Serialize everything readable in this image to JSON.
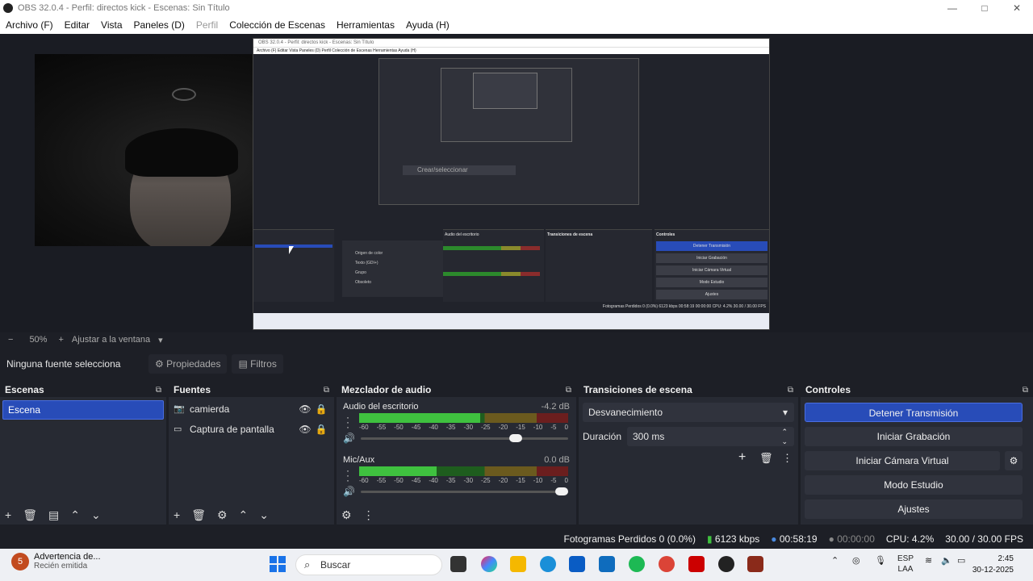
{
  "window": {
    "title": "OBS 32.0.4 - Perfil: directos kick - Escenas: Sin Título",
    "controls": {
      "minimize": "—",
      "maximize": "□",
      "close": "✕"
    }
  },
  "menu": {
    "items": [
      "Archivo (F)",
      "Editar",
      "Vista",
      "Paneles (D)",
      "Perfil",
      "Colección de Escenas",
      "Herramientas",
      "Ayuda (H)"
    ]
  },
  "zoom": {
    "minus": "−",
    "percent": "50%",
    "plus": "+",
    "fit": "Ajustar a la ventana",
    "arrow": "▾"
  },
  "context": {
    "no_source": "Ninguna fuente selecciona",
    "properties": "Propiedades",
    "filters": "Filtros"
  },
  "scenes": {
    "title": "Escenas",
    "items": [
      "Escena"
    ]
  },
  "sources": {
    "title": "Fuentes",
    "items": [
      {
        "name": "camierda",
        "icon": "camera-icon"
      },
      {
        "name": "Captura de pantalla",
        "icon": "monitor-icon"
      }
    ]
  },
  "mixer": {
    "title": "Mezclador de audio",
    "ticks": [
      "-60",
      "-55",
      "-50",
      "-45",
      "-40",
      "-35",
      "-30",
      "-25",
      "-20",
      "-15",
      "-10",
      "-5",
      "0"
    ],
    "channels": [
      {
        "name": "Audio del escritorio",
        "db": "-4.2 dB",
        "level": 0.58,
        "volume": 0.78
      },
      {
        "name": "Mic/Aux",
        "db": "0.0 dB",
        "level": 0.37,
        "volume": 1.0
      }
    ]
  },
  "transitions": {
    "title": "Transiciones de escena",
    "selected": "Desvanecimiento",
    "duration_label": "Duración",
    "duration_value": "300 ms"
  },
  "controls": {
    "title": "Controles",
    "stop_stream": "Detener Transmisión",
    "start_recording": "Iniciar Grabación",
    "virtual_camera": "Iniciar Cámara Virtual",
    "studio_mode": "Modo Estudio",
    "settings": "Ajustes"
  },
  "status": {
    "dropped": "Fotogramas Perdidos 0 (0.0%)",
    "bitrate": "6123 kbps",
    "stream_time": "00:58:19",
    "rec_time": "00:00:00",
    "cpu": "CPU: 4.2%",
    "fps": "30.00 / 30.00 FPS"
  },
  "nested_preview": {
    "title": "OBS 32.0.4 - Perfil: directos kick - Escenas: Sin Título",
    "menu": "Archivo (F)   Editar   Vista   Paneles (D)   Perfil   Colección de Escenas   Herramientas   Ayuda (H)",
    "tooltip": "Crear/seleccionar",
    "context_items": [
      "Origen de color",
      "Texto (GDI+)",
      "Grupo",
      "Obsoleto"
    ],
    "audio_label": "Audio del escritorio",
    "transitions": "Transiciones de escena",
    "controls": "Controles",
    "buttons": [
      "Detener Transmisión",
      "Iniciar Grabación",
      "Iniciar Cámara Virtual",
      "Modo Estudio",
      "Ajustes"
    ],
    "status": "Fotogramas Perdidos 0 (0.0%)   6123 kbps   00:58:19   00:00:00   CPU: 4.2%   30.00 / 30.00 FPS"
  },
  "taskbar": {
    "notification_badge": "5",
    "notification_title": "Advertencia de...",
    "notification_sub": "Recién emitida",
    "search": "Buscar",
    "lang_top": "ESP",
    "lang_bottom": "LAA",
    "time": "2:45",
    "date": "30-12-2025"
  },
  "colors": {
    "accent": "#284cb8",
    "dock_bg": "#272a33",
    "meter_green": "#3fc13f"
  }
}
